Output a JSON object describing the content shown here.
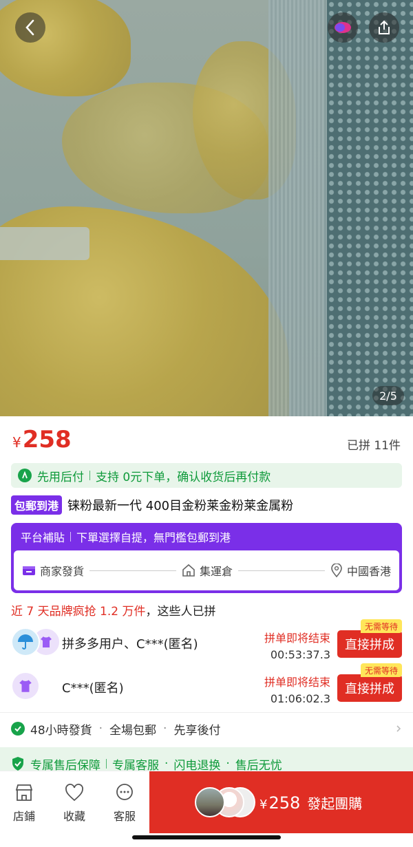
{
  "hero": {
    "image_counter": "2/5"
  },
  "price": {
    "currency": "¥",
    "amount": "258",
    "sold": "已拼 11件"
  },
  "pay_later": {
    "label": "先用后付",
    "text": "支持 0元下单，确认收货后再付款"
  },
  "product": {
    "tag": "包郵到港",
    "title": "铼粉最新一代 400目金粉莱金粉莱金属粉"
  },
  "shipping": {
    "title": "平台補貼",
    "subtitle": "下單選擇自提，無門檻包郵到港",
    "steps": [
      "商家發貨",
      "集運倉",
      "中國香港"
    ]
  },
  "group_buy": {
    "heading_highlight": "近 7 天品牌疯抢 1.2 万件",
    "heading_rest": "，这些人已拼",
    "groups": [
      {
        "name": "拼多多用户、C***(匿名)",
        "ending": "拼单即将结束",
        "countdown": "00:53:37.3",
        "badge": "无需等待",
        "button": "直接拼成"
      },
      {
        "name": "C***(匿名)",
        "ending": "拼单即将结束",
        "countdown": "01:06:02.3",
        "badge": "无需等待",
        "button": "直接拼成"
      }
    ]
  },
  "service": {
    "items": [
      "48小時發貨",
      "全場包郵",
      "先享後付"
    ],
    "dot": "·"
  },
  "guarantee": {
    "items": [
      "专属售后保障",
      "专属客服",
      "闪电退换",
      "售后无忧"
    ],
    "dot": "·"
  },
  "bottom_bar": {
    "store": "店鋪",
    "favorite": "收藏",
    "service": "客服",
    "buy_currency": "¥",
    "buy_amount": "258",
    "buy_label": "發起團購"
  },
  "colors": {
    "accent_red": "#e02e24",
    "purple": "#7a2fe8",
    "green": "#18a34a"
  }
}
